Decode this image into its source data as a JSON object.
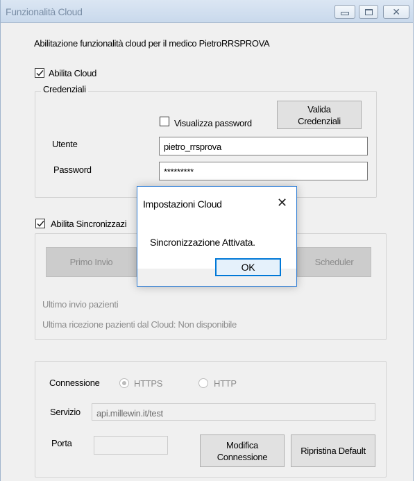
{
  "window": {
    "title": "Funzionalità Cloud",
    "subtitle": "Abilitazione funzionalità cloud per il medico  PietroRRSPROVA"
  },
  "cloud": {
    "enable_label": "Abilita Cloud",
    "enabled": true,
    "credentials": {
      "legend": "Credenziali",
      "show_password_label": "Visualizza password",
      "show_password_checked": false,
      "validate_button": "Valida\nCredenziali",
      "user_label": "Utente",
      "user_value": "pietro_rrsprova",
      "password_label": "Password",
      "password_value": "*********"
    }
  },
  "sync": {
    "enable_label": "Abilita Sincronizzazi",
    "enabled": true,
    "first_send_button": "Primo Invio",
    "scheduler_button": "Scheduler",
    "last_send_text": "Ultimo invio pazienti",
    "last_receive_text": "Ultima ricezione pazienti dal Cloud: Non disponibile"
  },
  "connection": {
    "label": "Connessione",
    "https_label": "HTTPS",
    "http_label": "HTTP",
    "selected": "HTTPS",
    "service_label": "Servizio",
    "service_value": "api.millewin.it/test",
    "port_label": "Porta",
    "port_value": "",
    "modify_button": "Modifica\nConnessione",
    "reset_button": "Ripristina Default"
  },
  "dialog": {
    "title": "Impostazioni Cloud",
    "message": "Sincronizzazione Attivata.",
    "ok_button": "OK"
  },
  "colors": {
    "accent": "#0078d7",
    "titlebar": "#c9d9ec",
    "window_bg": "#f0f0f0"
  }
}
